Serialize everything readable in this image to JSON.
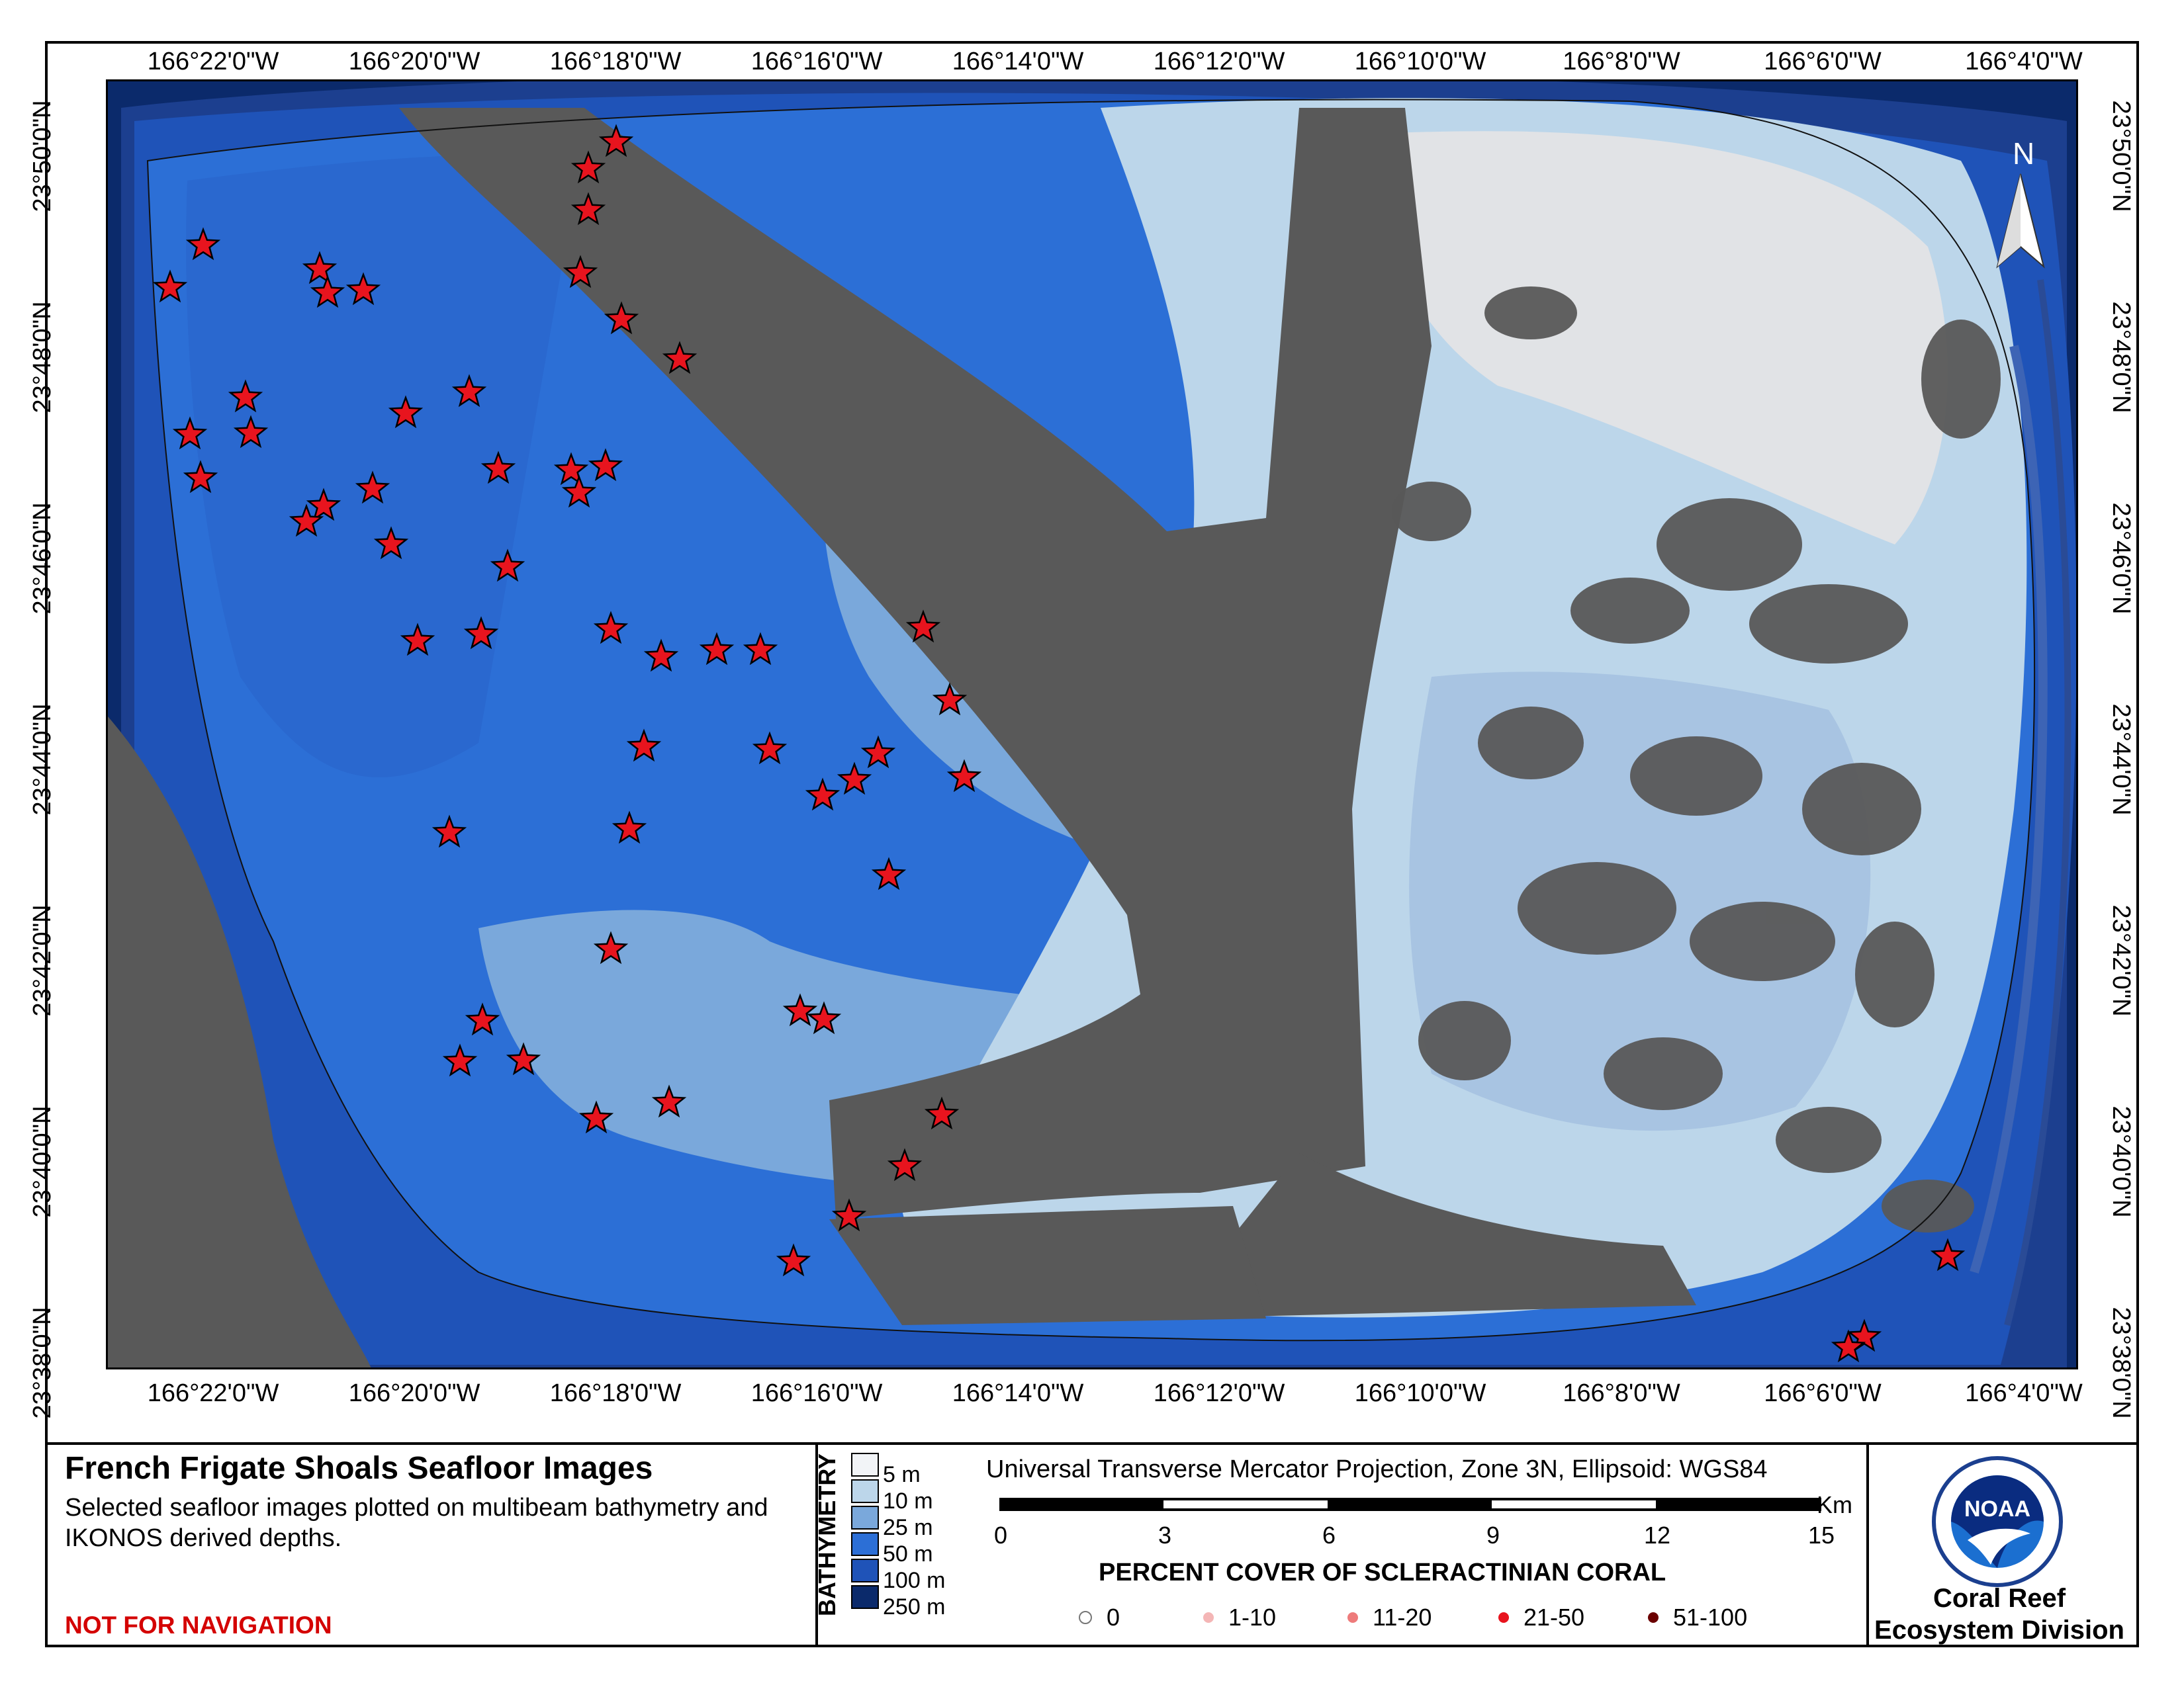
{
  "map": {
    "top_ticks": [
      "166°22'0\"W",
      "166°20'0\"W",
      "166°18'0\"W",
      "166°16'0\"W",
      "166°14'0\"W",
      "166°12'0\"W",
      "166°10'0\"W",
      "166°8'0\"W",
      "166°6'0\"W",
      "166°4'0\"W"
    ],
    "bottom_ticks": [
      "166°22'0\"W",
      "166°20'0\"W",
      "166°18'0\"W",
      "166°16'0\"W",
      "166°14'0\"W",
      "166°12'0\"W",
      "166°10'0\"W",
      "166°8'0\"W",
      "166°6'0\"W",
      "166°4'0\"W"
    ],
    "left_ticks": [
      "23°50'0\"N",
      "23°48'0\"N",
      "23°46'0\"N",
      "23°44'0\"N",
      "23°42'0\"N",
      "23°40'0\"N",
      "23°38'0\"N"
    ],
    "right_ticks": [
      "23°50'0\"N",
      "23°48'0\"N",
      "23°46'0\"N",
      "23°44'0\"N",
      "23°42'0\"N",
      "23°40'0\"N",
      "23°38'0\"N"
    ],
    "north_arrow_label": "N",
    "marker_color": "#e8141e"
  },
  "panel": {
    "title": "French Frigate Shoals Seafloor Images",
    "description": "Selected seafloor images plotted on multibeam bathymetry and IKONOS derived depths.",
    "warning": "NOT FOR NAVIGATION"
  },
  "bathymetry": {
    "label": "BATHYMETRY",
    "classes": [
      {
        "label": "5 m",
        "color": "#f2f4f7"
      },
      {
        "label": "10 m",
        "color": "#bcd6ea"
      },
      {
        "label": "25 m",
        "color": "#7aa8db"
      },
      {
        "label": "50 m",
        "color": "#2c6fd6"
      },
      {
        "label": "100 m",
        "color": "#1f53b8"
      },
      {
        "label": "250 m",
        "color": "#0b2a6b"
      }
    ]
  },
  "projection": {
    "text": "Universal Transverse Mercator Projection, Zone 3N, Ellipsoid: WGS84",
    "scale_ticks": [
      "0",
      "3",
      "6",
      "9",
      "12",
      "15"
    ],
    "scale_unit": "Km"
  },
  "coral_cover": {
    "title": "PERCENT COVER OF SCLERACTINIAN CORAL",
    "classes": [
      {
        "label": "0",
        "color": "#ffffff"
      },
      {
        "label": "1-10",
        "color": "#f4b6b6"
      },
      {
        "label": "11-20",
        "color": "#ee7b7b"
      },
      {
        "label": "21-50",
        "color": "#e8141e"
      },
      {
        "label": "51-100",
        "color": "#6b0000"
      }
    ]
  },
  "organization": {
    "logo_text": "NOAA",
    "name": "Coral Reef Ecosystem Division"
  }
}
